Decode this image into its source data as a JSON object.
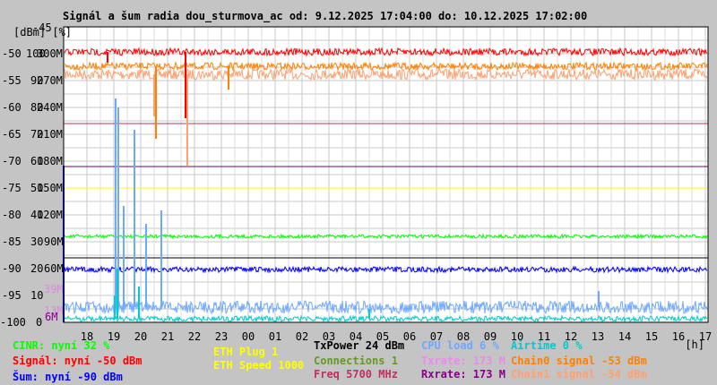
{
  "title": "Signál a šum radia dou_sturmova_ac od: 9.12.2025 17:04:00 do: 10.12.2025 17:02:00",
  "chart_data": {
    "type": "line",
    "title": "Signál a šum radia dou_sturmova_ac od: 9.12.2025 17:04:00 do: 10.12.2025 17:02:00",
    "xlabel": "[h]",
    "ylabel": "[dBm] [%]",
    "ylim": [
      -100,
      -45
    ],
    "x_ticks": [
      "18",
      "19",
      "20",
      "21",
      "22",
      "23",
      "00",
      "01",
      "02",
      "03",
      "04",
      "05",
      "06",
      "07",
      "08",
      "09",
      "10",
      "11",
      "12",
      "13",
      "14",
      "15",
      "16",
      "17"
    ],
    "y_ticks_dbm": [
      "-45",
      "-50",
      "-55",
      "-60",
      "-65",
      "-70",
      "-75",
      "-80",
      "-85",
      "-90",
      "-95",
      "-100"
    ],
    "y_ticks_pct": [
      "100",
      "90",
      "80",
      "70",
      "60",
      "50",
      "40",
      "30",
      "20",
      "10",
      "0"
    ],
    "y_ticks_rate": [
      "300M",
      "270M",
      "240M",
      "210M",
      "180M",
      "150M",
      "120M",
      "90M",
      "60M"
    ],
    "extra_rate_labels": [
      {
        "text": "39M",
        "color": "#dd88dd"
      },
      {
        "text": "13M",
        "color": "#dd88dd"
      },
      {
        "text": "6M",
        "color": "#880088"
      }
    ],
    "reference_lines": [
      {
        "name": "freq",
        "value_dbm": -63,
        "color": "#c03060"
      },
      {
        "name": "rxrate",
        "value_dbm": -71,
        "color": "#700070"
      },
      {
        "name": "eth-speed",
        "value_dbm": -75,
        "color": "#ffff00"
      },
      {
        "name": "txpower",
        "value_dbm": -88,
        "color": "#000000"
      }
    ],
    "series": [
      {
        "name": "Signál",
        "unit": "dBm",
        "approx": -50,
        "color": "#ff0000"
      },
      {
        "name": "Chain0 signal",
        "unit": "dBm",
        "approx": -53,
        "color": "#ff8000"
      },
      {
        "name": "Chain1 signal",
        "unit": "dBm",
        "approx": -54,
        "color": "#ffa070"
      },
      {
        "name": "CINR",
        "unit": "%",
        "approx": 32,
        "color": "#00ff00"
      },
      {
        "name": "Šum",
        "unit": "dBm",
        "approx": -90,
        "color": "#0000ff"
      },
      {
        "name": "CPU load",
        "unit": "%",
        "approx": 6,
        "color": "#6fa8ff"
      },
      {
        "name": "Airtime",
        "unit": "%",
        "approx": 0,
        "color": "#00cccc"
      }
    ]
  },
  "legend": {
    "cinr": "CINR: nyní 32 %",
    "signal": "Signál: nyní -50 dBm",
    "noise": "Šum: nyní -90 dBm",
    "eth_plug": "ETH Plug 1",
    "eth_speed": "ETH Speed 1000",
    "txpower": "TxPower 24 dBm",
    "connections": "Connections 1",
    "freq": "Freq 5700 MHz",
    "cpu": "CPU load 6 %",
    "txrate": "Txrate: 173 M",
    "rxrate": "Rxrate: 173 M",
    "airtime": "Airtime 0 %",
    "chain0": "Chain0 signal -53 dBm",
    "chain1": "Chain1 signal -54 dBm"
  }
}
